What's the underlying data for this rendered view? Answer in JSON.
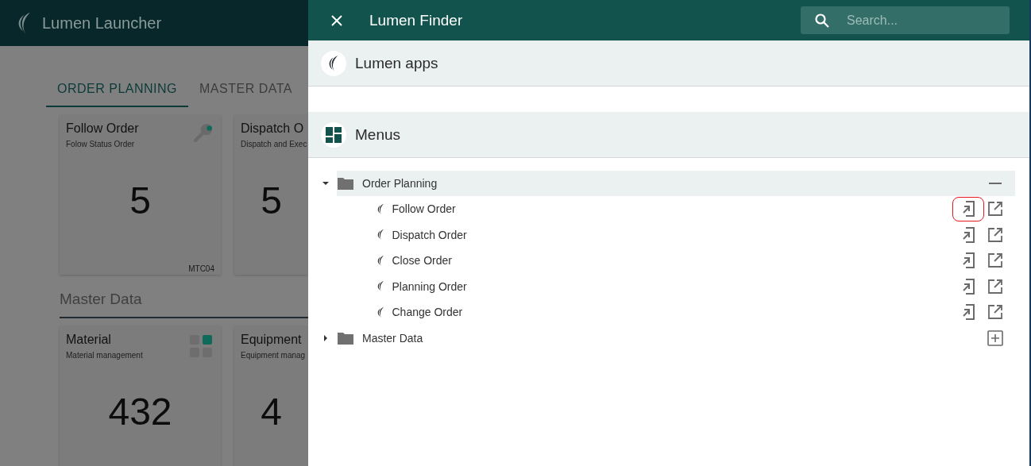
{
  "launcher": {
    "title": "Lumen Launcher",
    "tabs": [
      {
        "label": "ORDER PLANNING",
        "selected": true
      },
      {
        "label": "MASTER DATA",
        "selected": false
      }
    ],
    "groups": [
      {
        "cards": [
          {
            "title": "Follow Order",
            "subtitle": "Folow Status Order",
            "count": "5",
            "code": "MTC04",
            "kind": "wrench"
          },
          {
            "title": "Dispatch O",
            "subtitle": "Dispatch and Exec",
            "count": "5",
            "kind": "none"
          }
        ]
      },
      {
        "title": "Master Data",
        "cards": [
          {
            "title": "Material",
            "subtitle": "Material management",
            "count": "432",
            "kind": "blocks"
          },
          {
            "title": "Equipment",
            "subtitle": "Equipment manag",
            "count": "4",
            "kind": "none"
          }
        ]
      }
    ]
  },
  "finder": {
    "title": "Lumen Finder",
    "search": {
      "placeholder": "Search..."
    },
    "sections": [
      {
        "title": "Lumen apps",
        "kind": "apps"
      },
      {
        "title": "Menus",
        "kind": "menus"
      }
    ],
    "tree": [
      {
        "label": "Order Planning",
        "expanded": true,
        "children": [
          {
            "label": "Follow Order",
            "highlighted": true
          },
          {
            "label": "Dispatch Order",
            "highlighted": false
          },
          {
            "label": "Close Order",
            "highlighted": false
          },
          {
            "label": "Planning Order",
            "highlighted": false
          },
          {
            "label": "Change Order",
            "highlighted": false
          }
        ]
      },
      {
        "label": "Master Data",
        "expanded": false
      }
    ]
  }
}
